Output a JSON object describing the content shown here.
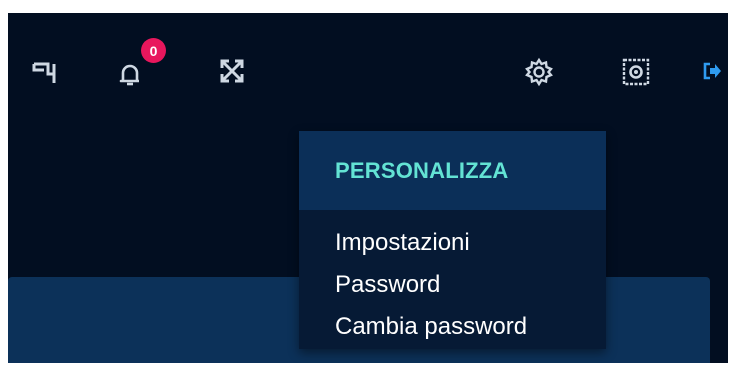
{
  "topbar": {
    "icons": {
      "flag": "flag-icon",
      "bell": "bell-icon",
      "expand": "expand-icon",
      "settings": "gear-icon",
      "screenshot": "camera-icon",
      "logout": "logout-icon"
    },
    "notifications_count": "0"
  },
  "dropdown": {
    "title": "PERSONALIZZA",
    "items": [
      {
        "label": "Impostazioni"
      },
      {
        "label": "Password"
      },
      {
        "label": "Cambia password"
      }
    ]
  },
  "colors": {
    "background": "#020e21",
    "dropdown_header": "#0b2f58",
    "dropdown_body": "#061a35",
    "title_accent": "#63e3d4",
    "badge": "#e8175d",
    "logout_accent": "#2f9bf0",
    "panel": "#0c3159"
  }
}
